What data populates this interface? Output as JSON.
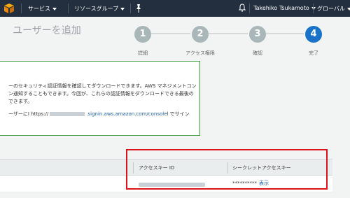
{
  "topbar": {
    "services_label": "サービス",
    "resource_groups_label": "リソースグループ",
    "user_label": "Takehiko Tsukamoto",
    "region_label": "グローバル"
  },
  "page": {
    "title": "ユーザーを追加"
  },
  "steps": [
    {
      "number": "1",
      "label": "詳細"
    },
    {
      "number": "2",
      "label": "アクセス権限"
    },
    {
      "number": "3",
      "label": "確認"
    },
    {
      "number": "4",
      "label": "完了"
    }
  ],
  "success": {
    "line1": "ーのセキュリティ認証情報を確認してダウンロードできます。AWS マネジメントコン",
    "line2": "ン通知することもできます。今回が、これらの認証情報をダウンロードできる最後の",
    "line3": "できます。",
    "line4_prefix": "ーザーにI https://",
    "line4_link": ".signin.aws.amazon.com/console",
    "line4_suffix": "l でサイン"
  },
  "table": {
    "col_access_key": "アクセスキー ID",
    "col_secret": "シークレットアクセスキー",
    "secret_masked": "**********",
    "secret_show": "表示"
  }
}
